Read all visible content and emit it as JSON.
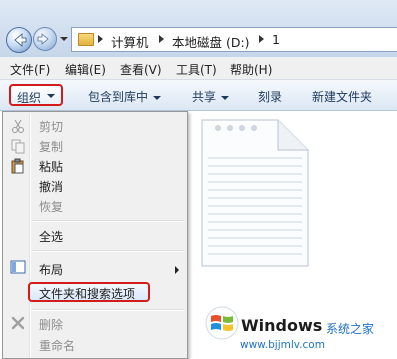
{
  "address_bar": {
    "crumbs": [
      "计算机",
      "本地磁盘 (D:)",
      "1"
    ]
  },
  "menubar": {
    "items": [
      "文件(F)",
      "编辑(E)",
      "查看(V)",
      "工具(T)",
      "帮助(H)"
    ]
  },
  "toolbar": {
    "organize": "组织",
    "include_in_library": "包含到库中",
    "share": "共享",
    "burn": "刻录",
    "new_folder": "新建文件夹"
  },
  "organize_menu": {
    "cut": "剪切",
    "copy": "复制",
    "paste": "粘贴",
    "undo": "撤消",
    "redo": "恢复",
    "select_all": "全选",
    "layout": "布局",
    "folder_and_search_options": "文件夹和搜索选项",
    "delete": "删除",
    "rename": "重命名"
  },
  "watermark": {
    "title": "Windows",
    "cn": "系统之家",
    "url": "www.bjjmlv.com"
  },
  "colors": {
    "highlight_border": "#d41b1b",
    "windows_blue": "#1e73c9"
  }
}
